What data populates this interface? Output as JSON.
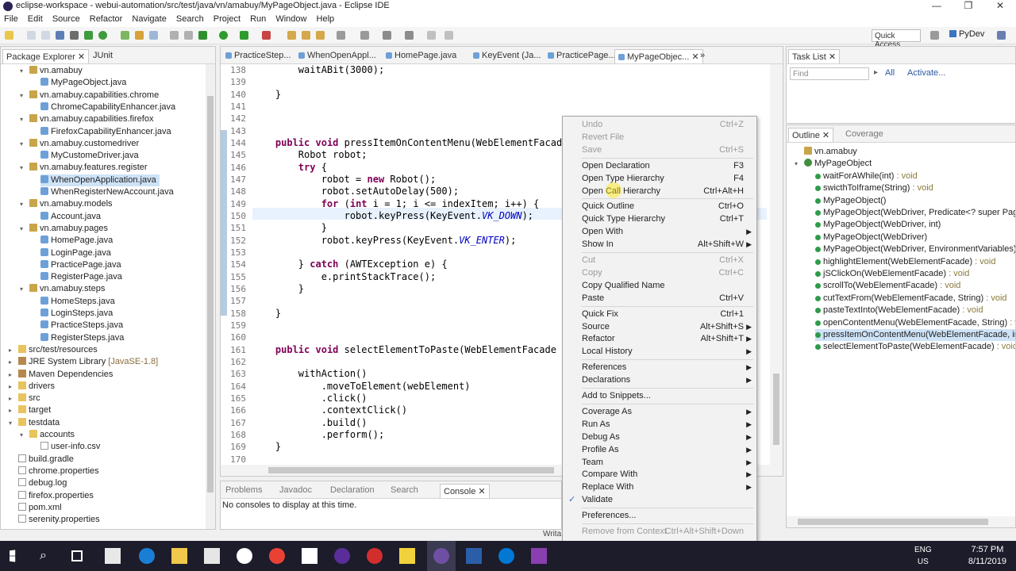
{
  "title": "eclipse-workspace - webui-automation/src/test/java/vn/amabuy/MyPageObject.java - Eclipse IDE",
  "menu": [
    "File",
    "Edit",
    "Source",
    "Refactor",
    "Navigate",
    "Search",
    "Project",
    "Run",
    "Window",
    "Help"
  ],
  "toolbar": {
    "quick_access": "Quick Access",
    "perspective": "PyDev"
  },
  "package_explorer": {
    "tabs": [
      "Package Explorer",
      "JUnit"
    ],
    "items": [
      {
        "label": "vn.amabuy",
        "type": "pkg",
        "indent": 1,
        "open": true
      },
      {
        "label": "MyPageObject.java",
        "type": "java",
        "indent": 2
      },
      {
        "label": "vn.amabuy.capabilities.chrome",
        "type": "pkg",
        "indent": 1,
        "open": true
      },
      {
        "label": "ChromeCapabilityEnhancer.java",
        "type": "java",
        "indent": 2
      },
      {
        "label": "vn.amabuy.capabilities.firefox",
        "type": "pkg",
        "indent": 1,
        "open": true
      },
      {
        "label": "FirefoxCapabilityEnhancer.java",
        "type": "java",
        "indent": 2
      },
      {
        "label": "vn.amabuy.customedriver",
        "type": "pkg",
        "indent": 1,
        "open": true
      },
      {
        "label": "MyCustomeDriver.java",
        "type": "java",
        "indent": 2
      },
      {
        "label": "vn.amabuy.features.register",
        "type": "pkg",
        "indent": 1,
        "open": true
      },
      {
        "label": "WhenOpenApplication.java",
        "type": "java",
        "indent": 2,
        "selected": true
      },
      {
        "label": "WhenRegisterNewAccount.java",
        "type": "java",
        "indent": 2
      },
      {
        "label": "vn.amabuy.models",
        "type": "pkg",
        "indent": 1,
        "open": true
      },
      {
        "label": "Account.java",
        "type": "java",
        "indent": 2
      },
      {
        "label": "vn.amabuy.pages",
        "type": "pkg",
        "indent": 1,
        "open": true
      },
      {
        "label": "HomePage.java",
        "type": "java",
        "indent": 2
      },
      {
        "label": "LoginPage.java",
        "type": "java",
        "indent": 2
      },
      {
        "label": "PracticePage.java",
        "type": "java",
        "indent": 2
      },
      {
        "label": "RegisterPage.java",
        "type": "java",
        "indent": 2
      },
      {
        "label": "vn.amabuy.steps",
        "type": "pkg",
        "indent": 1,
        "open": true
      },
      {
        "label": "HomeSteps.java",
        "type": "java",
        "indent": 2
      },
      {
        "label": "LoginSteps.java",
        "type": "java",
        "indent": 2
      },
      {
        "label": "PracticeSteps.java",
        "type": "java",
        "indent": 2
      },
      {
        "label": "RegisterSteps.java",
        "type": "java",
        "indent": 2
      },
      {
        "label": "src/test/resources",
        "type": "fold",
        "indent": 0,
        "open": false
      },
      {
        "label": "JRE System Library",
        "suffix": " [JavaSE-1.8]",
        "type": "jre",
        "indent": 0,
        "open": false
      },
      {
        "label": "Maven Dependencies",
        "type": "jre",
        "indent": 0,
        "open": false
      },
      {
        "label": "drivers",
        "type": "fold",
        "indent": 0,
        "open": false
      },
      {
        "label": "src",
        "type": "fold",
        "indent": 0,
        "open": false
      },
      {
        "label": "target",
        "type": "fold",
        "indent": 0,
        "open": false
      },
      {
        "label": "testdata",
        "type": "fold",
        "indent": 0,
        "open": true
      },
      {
        "label": "accounts",
        "type": "fold",
        "indent": 1,
        "open": true
      },
      {
        "label": "user-info.csv",
        "type": "file",
        "indent": 2
      },
      {
        "label": "build.gradle",
        "type": "file",
        "indent": 0
      },
      {
        "label": "chrome.properties",
        "type": "file",
        "indent": 0
      },
      {
        "label": "debug.log",
        "type": "file",
        "indent": 0
      },
      {
        "label": "firefox.properties",
        "type": "file",
        "indent": 0
      },
      {
        "label": "pom.xml",
        "type": "file",
        "indent": 0
      },
      {
        "label": "serenity.properties",
        "type": "file",
        "indent": 0
      }
    ]
  },
  "editor_tabs": [
    "PracticeStep...",
    "WhenOpenAppl...",
    "HomePage.java",
    "KeyEvent (Ja...",
    "PracticePage...",
    "MyPageObjec..."
  ],
  "editor_overflow": "»",
  "code": [
    {
      "n": "138",
      "t": "        waitABit(3000);"
    },
    {
      "n": "139",
      "t": ""
    },
    {
      "n": "140",
      "t": "    }"
    },
    {
      "n": "141",
      "t": ""
    },
    {
      "n": "142",
      "t": ""
    },
    {
      "n": "143",
      "t": ""
    },
    {
      "n": "144",
      "t": "    public void pressItemOnContentMenu(WebElementFacad"
    },
    {
      "n": "145",
      "t": "        Robot robot;"
    },
    {
      "n": "146",
      "t": "        try {"
    },
    {
      "n": "147",
      "t": "            robot = new Robot();"
    },
    {
      "n": "148",
      "t": "            robot.setAutoDelay(500);"
    },
    {
      "n": "149",
      "t": "            for (int i = 1; i <= indexItem; i++) {"
    },
    {
      "n": "150",
      "t": "                robot.keyPress(KeyEvent.VK_DOWN);"
    },
    {
      "n": "151",
      "t": "            }"
    },
    {
      "n": "152",
      "t": "            robot.keyPress(KeyEvent.VK_ENTER);"
    },
    {
      "n": "153",
      "t": ""
    },
    {
      "n": "154",
      "t": "        } catch (AWTException e) {"
    },
    {
      "n": "155",
      "t": "            e.printStackTrace();"
    },
    {
      "n": "156",
      "t": "        }"
    },
    {
      "n": "157",
      "t": ""
    },
    {
      "n": "158",
      "t": "    }"
    },
    {
      "n": "159",
      "t": ""
    },
    {
      "n": "160",
      "t": ""
    },
    {
      "n": "161",
      "t": "    public void selectElementToPaste(WebElementFacade"
    },
    {
      "n": "162",
      "t": ""
    },
    {
      "n": "163",
      "t": "        withAction()"
    },
    {
      "n": "164",
      "t": "            .moveToElement(webElement)"
    },
    {
      "n": "165",
      "t": "            .click()"
    },
    {
      "n": "166",
      "t": "            .contextClick()"
    },
    {
      "n": "167",
      "t": "            .build()"
    },
    {
      "n": "168",
      "t": "            .perform();"
    },
    {
      "n": "169",
      "t": "    }"
    },
    {
      "n": "170",
      "t": ""
    }
  ],
  "context_menu": [
    {
      "label": "Undo",
      "sc": "Ctrl+Z",
      "dis": true
    },
    {
      "label": "Revert File",
      "sc": "",
      "dis": true
    },
    {
      "label": "Save",
      "sc": "Ctrl+S",
      "dis": true
    },
    {
      "sep": true
    },
    {
      "label": "Open Declaration",
      "sc": "F3"
    },
    {
      "label": "Open Type Hierarchy",
      "sc": "F4"
    },
    {
      "label": "Open Call Hierarchy",
      "sc": "Ctrl+Alt+H"
    },
    {
      "sep": true
    },
    {
      "label": "Quick Outline",
      "sc": "Ctrl+O"
    },
    {
      "label": "Quick Type Hierarchy",
      "sc": "Ctrl+T"
    },
    {
      "label": "Open With",
      "sc": "",
      "sub": true
    },
    {
      "label": "Show In",
      "sc": "Alt+Shift+W",
      "sub": true
    },
    {
      "sep": true
    },
    {
      "label": "Cut",
      "sc": "Ctrl+X",
      "dis": true
    },
    {
      "label": "Copy",
      "sc": "Ctrl+C",
      "dis": true
    },
    {
      "label": "Copy Qualified Name",
      "sc": ""
    },
    {
      "label": "Paste",
      "sc": "Ctrl+V"
    },
    {
      "sep": true
    },
    {
      "label": "Quick Fix",
      "sc": "Ctrl+1"
    },
    {
      "label": "Source",
      "sc": "Alt+Shift+S",
      "sub": true
    },
    {
      "label": "Refactor",
      "sc": "Alt+Shift+T",
      "sub": true
    },
    {
      "label": "Local History",
      "sc": "",
      "sub": true
    },
    {
      "sep": true
    },
    {
      "label": "References",
      "sc": "",
      "sub": true
    },
    {
      "label": "Declarations",
      "sc": "",
      "sub": true
    },
    {
      "sep": true
    },
    {
      "label": "Add to Snippets...",
      "sc": ""
    },
    {
      "sep": true
    },
    {
      "label": "Coverage As",
      "sc": "",
      "sub": true
    },
    {
      "label": "Run As",
      "sc": "",
      "sub": true
    },
    {
      "label": "Debug As",
      "sc": "",
      "sub": true
    },
    {
      "label": "Profile As",
      "sc": "",
      "sub": true
    },
    {
      "label": "Team",
      "sc": "",
      "sub": true
    },
    {
      "label": "Compare With",
      "sc": "",
      "sub": true
    },
    {
      "label": "Replace With",
      "sc": "",
      "sub": true
    },
    {
      "label": "Validate",
      "sc": "",
      "check": true
    },
    {
      "sep": true
    },
    {
      "label": "Preferences...",
      "sc": ""
    },
    {
      "sep": true
    },
    {
      "label": "Remove from Context",
      "sc": "Ctrl+Alt+Shift+Down",
      "dis": true
    }
  ],
  "task_list": {
    "tab": "Task List",
    "find_placeholder": "Find",
    "all": "All",
    "activate": "Activate..."
  },
  "outline": {
    "tabs": [
      "Outline",
      "Coverage"
    ],
    "items": [
      {
        "label": "vn.amabuy",
        "type": "pkg",
        "indent": 0
      },
      {
        "label": "MyPageObject",
        "type": "cls",
        "indent": 0,
        "open": true
      },
      {
        "label": "waitForAWhile(int)",
        "ret": " : void",
        "indent": 1
      },
      {
        "label": "swicthToIframe(String)",
        "ret": " : void",
        "indent": 1
      },
      {
        "label": "MyPageObject()",
        "ret": "",
        "indent": 1
      },
      {
        "label": "MyPageObject(WebDriver, Predicate<? super PageObj",
        "ret": "",
        "indent": 1
      },
      {
        "label": "MyPageObject(WebDriver, int)",
        "ret": "",
        "indent": 1
      },
      {
        "label": "MyPageObject(WebDriver)",
        "ret": "",
        "indent": 1
      },
      {
        "label": "MyPageObject(WebDriver, EnvironmentVariables)",
        "ret": "",
        "indent": 1
      },
      {
        "label": "highlightElement(WebElementFacade)",
        "ret": " : void",
        "indent": 1
      },
      {
        "label": "jSClickOn(WebElementFacade)",
        "ret": " : void",
        "indent": 1
      },
      {
        "label": "scrollTo(WebElementFacade)",
        "ret": " : void",
        "indent": 1
      },
      {
        "label": "cutTextFrom(WebElementFacade, String)",
        "ret": " : void",
        "indent": 1
      },
      {
        "label": "pasteTextInto(WebElementFacade)",
        "ret": " : void",
        "indent": 1
      },
      {
        "label": "openContentMenu(WebElementFacade, String)",
        "ret": " : void",
        "indent": 1
      },
      {
        "label": "pressItemOnContentMenu(WebElementFacade, int)",
        "ret": " : vo",
        "indent": 1,
        "selected": true
      },
      {
        "label": "selectElementToPaste(WebElementFacade)",
        "ret": " : void",
        "indent": 1
      }
    ]
  },
  "bottom_panel": {
    "tabs": [
      "Problems",
      "Javadoc",
      "Declaration",
      "Search",
      "Console"
    ],
    "message": "No consoles to display at this time."
  },
  "status": {
    "writable": "Writa"
  },
  "taskbar": {
    "ime": "ENG",
    "ime2": "US",
    "time": "7:57 PM",
    "date": "8/11/2019"
  },
  "colors": {
    "selection": "#cfe3f7",
    "menu_bg": "#f2f2f2",
    "keyword": "#7f0055",
    "field": "#0000c0"
  }
}
